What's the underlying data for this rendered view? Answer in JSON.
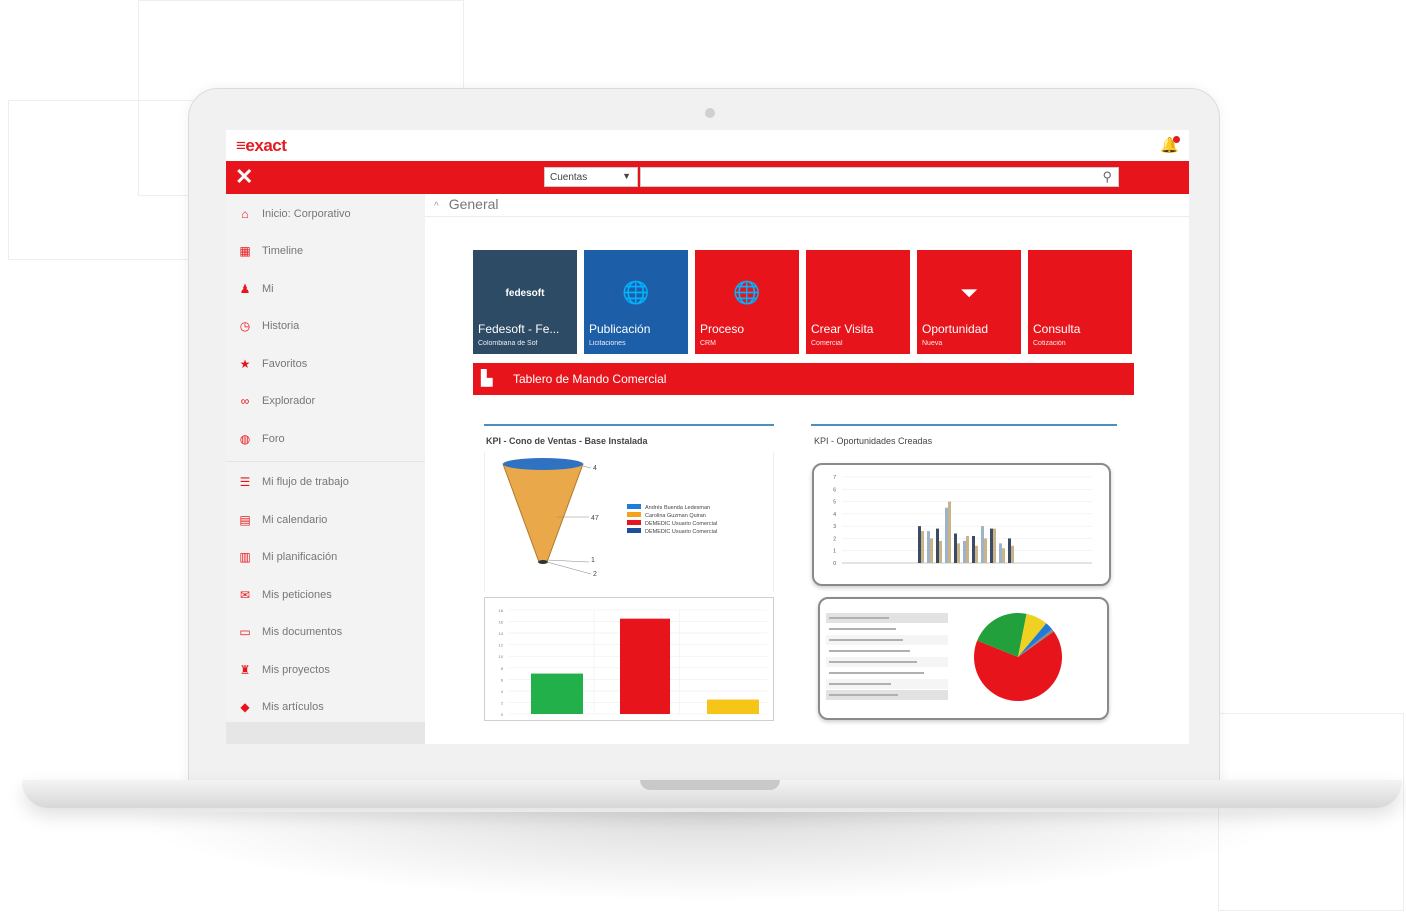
{
  "app": {
    "logo": "≡exact",
    "search_scope": "Cuentas",
    "search_placeholder": ""
  },
  "sidebar": {
    "items": [
      {
        "label": "Inicio: Corporativo",
        "icon": "home-icon",
        "glyph": "⌂"
      },
      {
        "label": "Timeline",
        "icon": "timeline-icon",
        "glyph": "▦"
      },
      {
        "label": "Mi",
        "icon": "user-icon",
        "glyph": "♟"
      },
      {
        "label": "Historia",
        "icon": "history-icon",
        "glyph": "◷"
      },
      {
        "label": "Favoritos",
        "icon": "star-icon",
        "glyph": "★"
      },
      {
        "label": "Explorador",
        "icon": "binoculars-icon",
        "glyph": "∞"
      },
      {
        "label": "Foro",
        "icon": "forum-icon",
        "glyph": "◍"
      },
      {
        "label": "Mi flujo de trabajo",
        "icon": "workflow-icon",
        "glyph": "☰"
      },
      {
        "label": "Mi calendario",
        "icon": "calendar-icon",
        "glyph": "▤"
      },
      {
        "label": "Mi planificación",
        "icon": "planning-icon",
        "glyph": "▥"
      },
      {
        "label": "Mis peticiones",
        "icon": "requests-icon",
        "glyph": "✉"
      },
      {
        "label": "Mis documentos",
        "icon": "documents-icon",
        "glyph": "▭"
      },
      {
        "label": "Mis proyectos",
        "icon": "projects-icon",
        "glyph": "♜"
      },
      {
        "label": "Mis artículos",
        "icon": "articles-icon",
        "glyph": "◆"
      }
    ]
  },
  "main": {
    "section_title": "General",
    "tiles": [
      {
        "label": "Fedesoft - Fe...",
        "sub": "Colombiana de Sof",
        "icon": "fedesoft-logo-icon",
        "glyph": "fedesoft",
        "color": "#2e4b66"
      },
      {
        "label": "Publicación",
        "sub": "Licitaciones",
        "icon": "web-icon",
        "glyph": "🌐",
        "color": "#1d5ea8"
      },
      {
        "label": "Proceso",
        "sub": "CRM",
        "icon": "web-icon",
        "glyph": "🌐",
        "color": "#e8141b"
      },
      {
        "label": "Crear Visita",
        "sub": "Comercial",
        "icon": "",
        "glyph": "",
        "color": "#e8141b"
      },
      {
        "label": "Oportunidad",
        "sub": "Nueva",
        "icon": "funnel-icon",
        "glyph": "⏷",
        "color": "#e8141b"
      },
      {
        "label": "Consulta",
        "sub": "Cotización",
        "icon": "",
        "glyph": "",
        "color": "#e8141b"
      }
    ],
    "dashboard_title": "Tablero de Mando Comercial",
    "kpi_left_title": "KPI - Cono de Ventas - Base Instalada",
    "kpi_right_title": "KPI - Oportunidades Creadas"
  },
  "chart_data": [
    {
      "type": "funnel",
      "labels": [
        "4",
        "47",
        "1",
        "2"
      ],
      "values": [
        4,
        47,
        1,
        2
      ],
      "legend": [
        {
          "name": "Andrés Buenda Ledesman",
          "color": "#1f7bd6"
        },
        {
          "name": "Carolina Guzman Quiran",
          "color": "#f4a21e"
        },
        {
          "name": "DEMEDIC Usuario Comercial",
          "color": "#e8141b"
        },
        {
          "name": "DEMEDIC Usuario Comercial",
          "color": "#1d4f9a"
        }
      ]
    },
    {
      "type": "bar",
      "ylim": [
        0,
        7
      ],
      "yticks": [
        "7",
        "6",
        "5",
        "4",
        "3",
        "2",
        "1",
        "0"
      ],
      "groups": [
        [
          3.0,
          2.6,
          2.8,
          4.5,
          2.4,
          1.8,
          2.2,
          3.0,
          2.8,
          1.6,
          2.0
        ],
        [
          2.6,
          2.0,
          1.8,
          5.0,
          1.6,
          2.2,
          1.4,
          2.0,
          2.8,
          1.2,
          1.4
        ]
      ],
      "series_colors": [
        "#3b4a66",
        "#c9b48a",
        "#9fb3c8"
      ]
    },
    {
      "type": "bar",
      "ylim": [
        0,
        18
      ],
      "values": [
        7,
        16.5,
        2.5
      ],
      "colors": [
        "#22b04b",
        "#e8141b",
        "#f5c518"
      ]
    },
    {
      "type": "pie",
      "values": [
        66,
        22,
        8,
        3,
        1
      ],
      "colors": [
        "#e8141b",
        "#22a03b",
        "#f0d020",
        "#1f7bd6",
        "#8a8a8a"
      ]
    }
  ]
}
